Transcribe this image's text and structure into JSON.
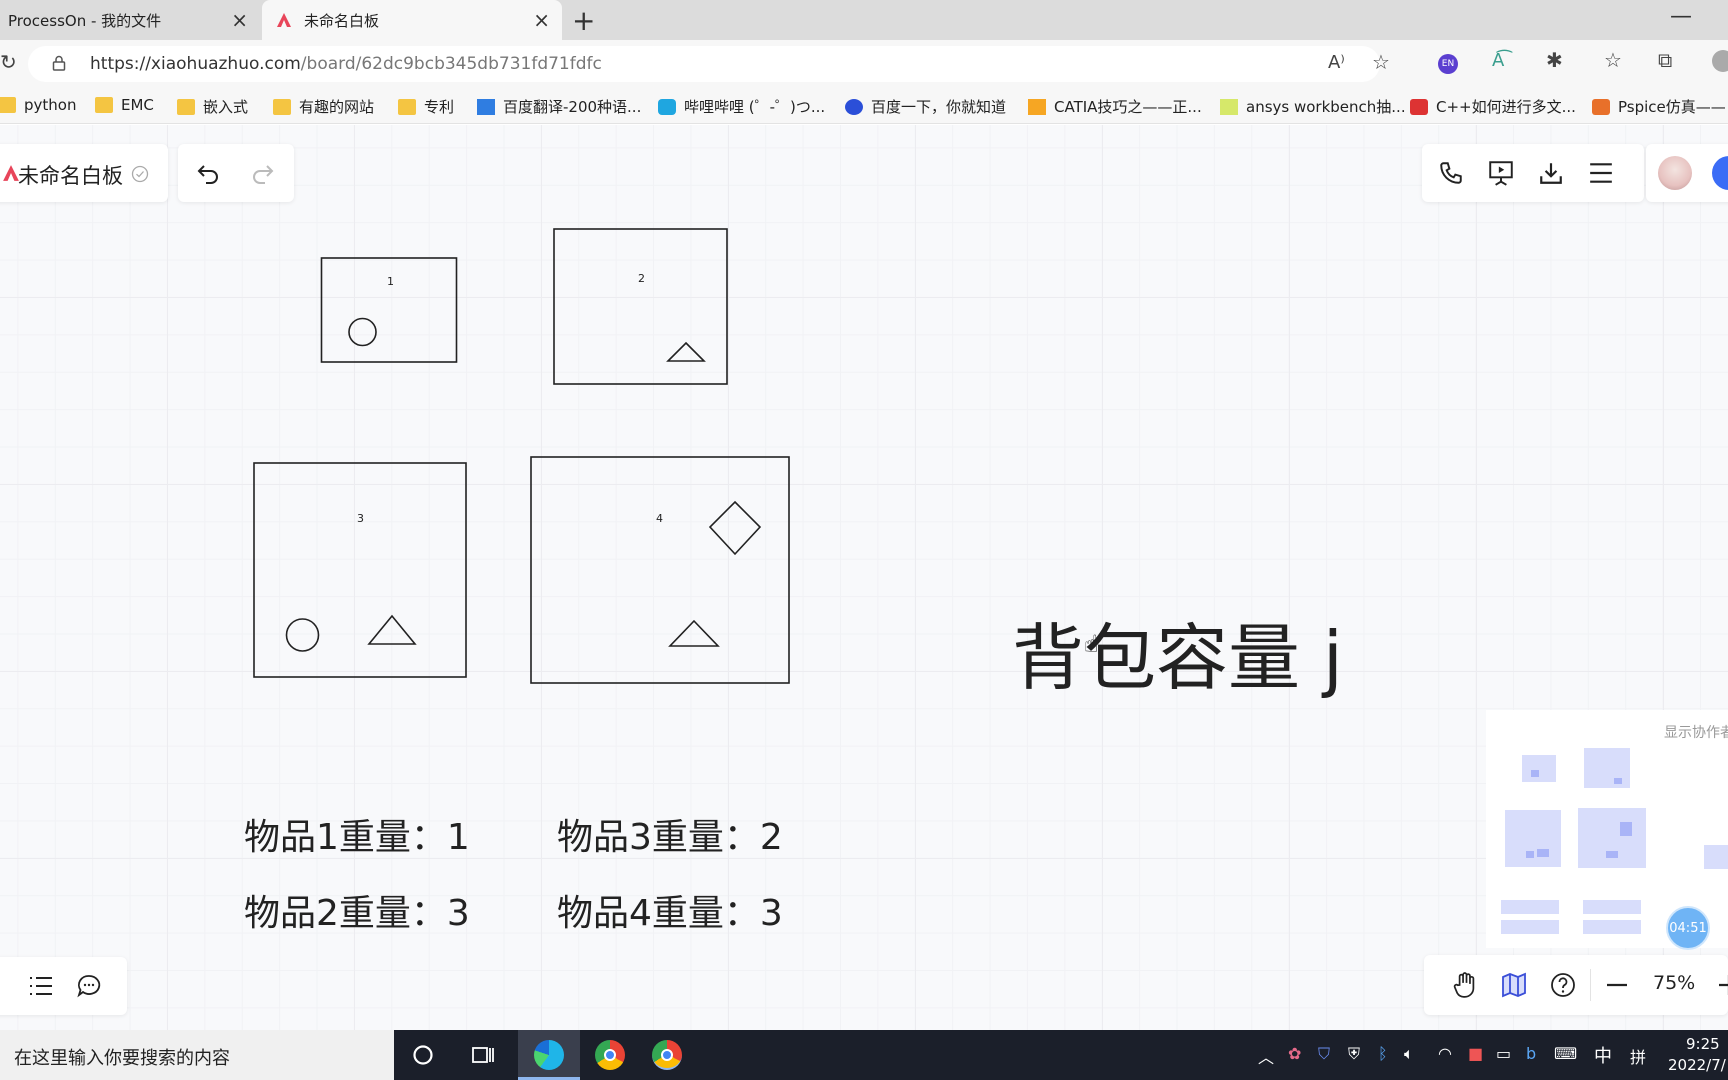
{
  "browser": {
    "tabs": [
      {
        "title": "ProcessOn - 我的文件"
      },
      {
        "title": "未命名白板"
      }
    ],
    "url_host": "https://xiaohuazhuo.com",
    "url_path": "/board/62dc9bcb345db731fd71fdfc",
    "bookmarks": [
      "python",
      "EMC",
      "嵌入式",
      "有趣的网站",
      "专利",
      "百度翻译-200种语...",
      "哔哩哔哩 (゜-゜)つ...",
      "百度一下，你就知道",
      "CATIA技巧之——正...",
      "ansys workbench抽...",
      "C++如何进行多文...",
      "Pspice仿真——"
    ],
    "profile_badge": "EN"
  },
  "board": {
    "title": "未命名白板",
    "shapes": [
      {
        "label": "1"
      },
      {
        "label": "2"
      },
      {
        "label": "3"
      },
      {
        "label": "4"
      }
    ],
    "weights": [
      "物品1重量：1",
      "物品3重量：2",
      "物品2重量：3",
      "物品4重量：3"
    ],
    "capacity_text": "背包容量 j",
    "minimap_label": "显示协作者",
    "timer": "04:51",
    "zoom": "75%"
  },
  "taskbar": {
    "search_placeholder": "在这里输入你要搜索的内容",
    "ime": "中",
    "ime2": "拼",
    "time": "9:25",
    "date": "2022/7/"
  },
  "colors": {
    "accent": "#3b6cf6",
    "logo": "#e8455a",
    "stroke": "#222222"
  }
}
